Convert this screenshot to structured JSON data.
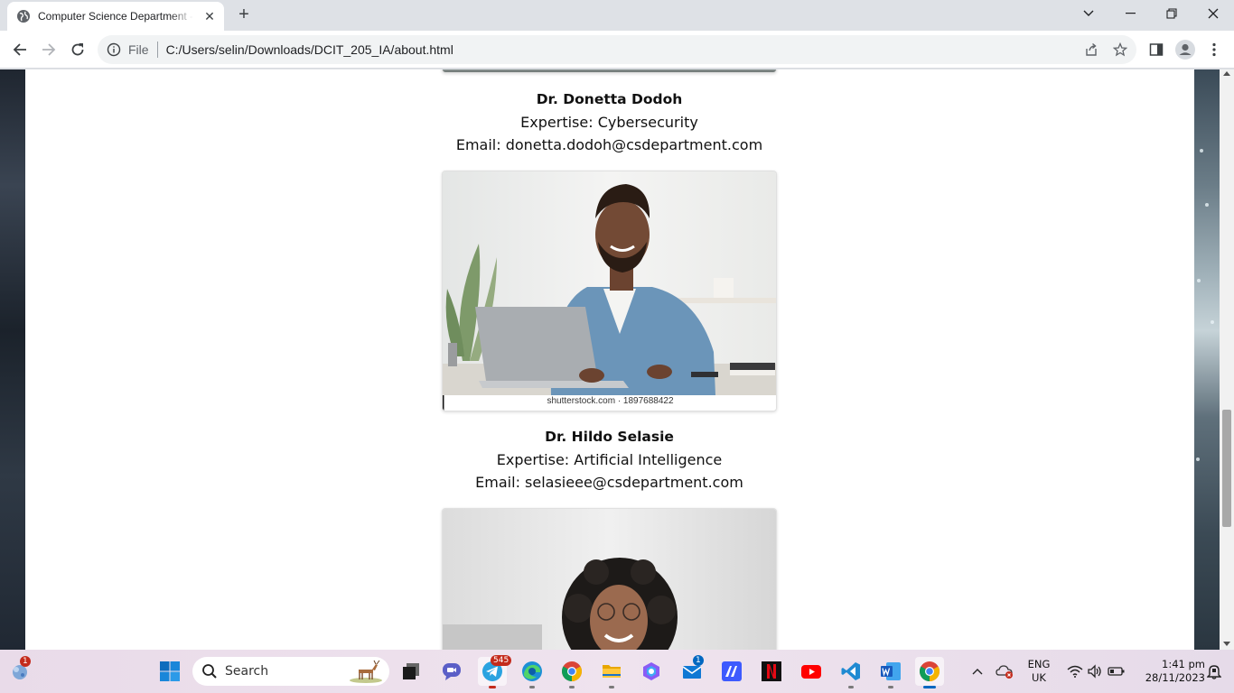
{
  "browser": {
    "tab_title": "Computer Science Department - ",
    "new_tab_label": "+",
    "address_scheme": "File",
    "address_url": "C:/Users/selin/Downloads/DCIT_205_IA/about.html"
  },
  "page": {
    "staff": [
      {
        "name": "Dr. Donetta Dodoh",
        "expertise": "Expertise: Cybersecurity",
        "email": "Email: donetta.dodoh@csdepartment.com"
      },
      {
        "name": "Dr. Hildo Selasie",
        "expertise": "Expertise: Artificial Intelligence",
        "email": "Email: selasieee@csdepartment.com",
        "photo_watermark": "shutterstock.com · 1897688422"
      }
    ]
  },
  "taskbar": {
    "search_label": "Search",
    "widgets_badge": "1",
    "telegram_badge": "545",
    "mail_badge": "1",
    "language_line1": "ENG",
    "language_line2": "UK",
    "time": "1:41 pm",
    "date": "28/11/2023"
  },
  "colors": {
    "tab_strip": "#dee1e6",
    "page_background": "#ffffff",
    "windows_blue": "#0067c0",
    "badge_red": "#c42b1c"
  }
}
